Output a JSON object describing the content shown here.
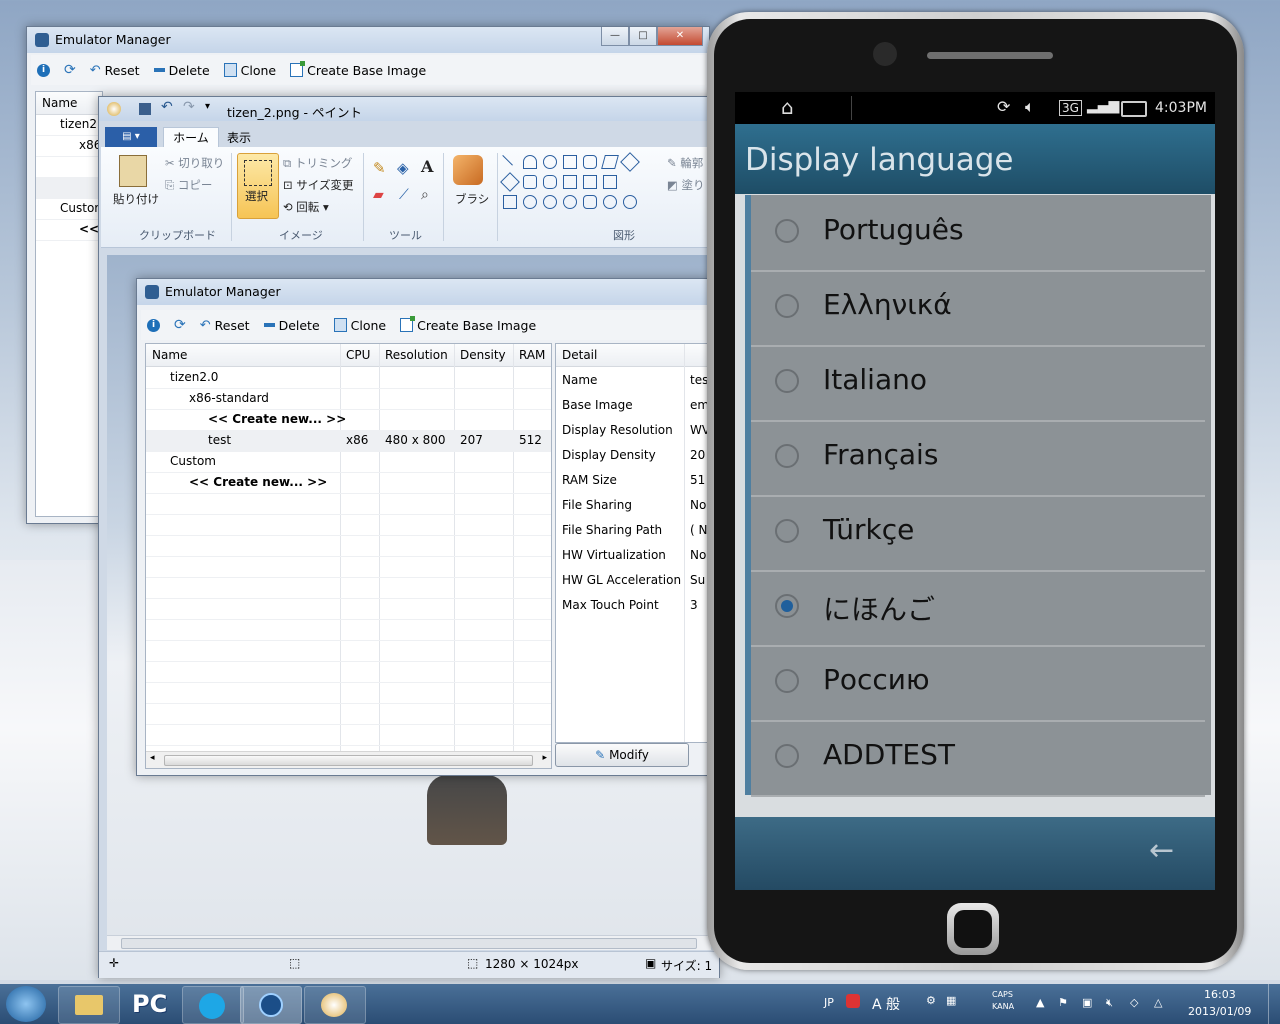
{
  "emulator_manager_back": {
    "title": "Emulator Manager",
    "toolbar": {
      "reset": "Reset",
      "delete": "Delete",
      "clone": "Clone",
      "create_base_image": "Create Base Image"
    },
    "header_name": "Name",
    "rows": [
      "tizen2.",
      "x86",
      "Custor",
      "<<"
    ]
  },
  "paint": {
    "title": "tizen_2.png - ペイント",
    "tabs": [
      "ホーム",
      "表示"
    ],
    "clipboard": {
      "paste": "貼り付け",
      "cut": "切り取り",
      "copy": "コピー",
      "group": "クリップボード"
    },
    "image": {
      "select": "選択",
      "crop": "トリミング",
      "resize": "サイズ変更",
      "rotate": "回転",
      "group": "イメージ"
    },
    "tools": {
      "group": "ツール"
    },
    "brush": "ブラシ",
    "shapes": {
      "group": "図形"
    },
    "outline": "輪郭",
    "fill": "塗り",
    "status": {
      "dimensions": "1280 × 1024px",
      "size_label": "サイズ: 1"
    }
  },
  "emulator_manager_front": {
    "title": "Emulator Manager",
    "toolbar": {
      "reset": "Reset",
      "delete": "Delete",
      "clone": "Clone",
      "create_base_image": "Create Base Image"
    },
    "columns": [
      "Name",
      "CPU",
      "Resolution",
      "Density",
      "RAM"
    ],
    "rows": [
      {
        "name": "tizen2.0",
        "cpu": "",
        "resolution": "",
        "density": "",
        "ram": ""
      },
      {
        "name": "x86-standard",
        "cpu": "",
        "resolution": "",
        "density": "",
        "ram": ""
      },
      {
        "name": "<< Create new... >>",
        "cpu": "",
        "resolution": "",
        "density": "",
        "ram": ""
      },
      {
        "name": "test",
        "cpu": "x86",
        "resolution": "480 x 800",
        "density": "207",
        "ram": "512"
      },
      {
        "name": "Custom",
        "cpu": "",
        "resolution": "",
        "density": "",
        "ram": ""
      },
      {
        "name": "<< Create new... >>",
        "cpu": "",
        "resolution": "",
        "density": "",
        "ram": ""
      }
    ],
    "detail_header": "Detail",
    "detail": [
      {
        "key": "Name",
        "value": "tes"
      },
      {
        "key": "Base Image",
        "value": "em"
      },
      {
        "key": "Display Resolution",
        "value": "WV"
      },
      {
        "key": "Display Density",
        "value": "20"
      },
      {
        "key": "RAM Size",
        "value": "51"
      },
      {
        "key": "File Sharing",
        "value": "No"
      },
      {
        "key": "File Sharing Path",
        "value": "( N"
      },
      {
        "key": "HW Virtualization",
        "value": "No"
      },
      {
        "key": "HW GL Acceleration",
        "value": "Su"
      },
      {
        "key": "Max Touch Point",
        "value": "3"
      }
    ],
    "modify_button": "Modify"
  },
  "phone": {
    "status_time": "4:03PM",
    "network": "3G",
    "title": "Display language",
    "languages": [
      "Português",
      "Ελληνικά",
      "Italiano",
      "Français",
      "Türkçe",
      "にほんご",
      "Россию",
      "ADDTEST"
    ],
    "selected": "にほんご"
  },
  "taskbar": {
    "pc_label": "PC",
    "ime": "JP",
    "ime_mode": "A 般",
    "caps": "CAPS",
    "kana": "KANA",
    "time": "16:03",
    "date": "2013/01/09"
  },
  "colors": {
    "accent": "#1f5f9c",
    "appbar": "#2f6f8f",
    "taskbar": "#2b4d74"
  }
}
